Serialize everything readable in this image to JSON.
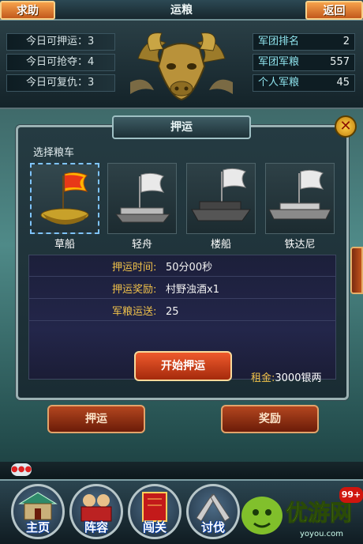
{
  "header": {
    "title": "运粮",
    "help_label": "求助",
    "back_label": "返回"
  },
  "stats_left": [
    {
      "label": "今日可押运：3"
    },
    {
      "label": "今日可抢夺：4"
    },
    {
      "label": "今日可复仇：3"
    }
  ],
  "stats_right": [
    {
      "label": "军团排名",
      "value": "2"
    },
    {
      "label": "军团军粮",
      "value": "557"
    },
    {
      "label": "个人军粮",
      "value": "45"
    }
  ],
  "dialog": {
    "title": "押运",
    "select_label": "选择粮车",
    "boats": [
      {
        "name": "草船",
        "selected": true
      },
      {
        "name": "轻舟",
        "selected": false
      },
      {
        "name": "楼船",
        "selected": false
      },
      {
        "name": "铁达尼",
        "selected": false
      }
    ],
    "info": [
      {
        "key": "押运时间:",
        "value": "50分00秒"
      },
      {
        "key": "押运奖励:",
        "value": "村野浊酒x1"
      },
      {
        "key": "军粮运送:",
        "value": "25"
      }
    ],
    "start_label": "开始押运",
    "rent_key": "租金:",
    "rent_value": "3000银两"
  },
  "buttons": {
    "escort": "押运",
    "reward": "奖励"
  },
  "nav": [
    {
      "label": "主页",
      "icon": "palace-icon"
    },
    {
      "label": "阵容",
      "icon": "warriors-icon"
    },
    {
      "label": "闯关",
      "icon": "scroll-icon"
    },
    {
      "label": "讨伐",
      "icon": "battle-icon"
    }
  ],
  "badge": "99+",
  "watermark": {
    "text": "优游网",
    "sub": "yoyou.com"
  },
  "colors": {
    "accent_orange": "#f29a44",
    "label_gold": "#f1c24a",
    "stat_cyan": "#8fe4ee",
    "nav_label": "#ffffff"
  }
}
